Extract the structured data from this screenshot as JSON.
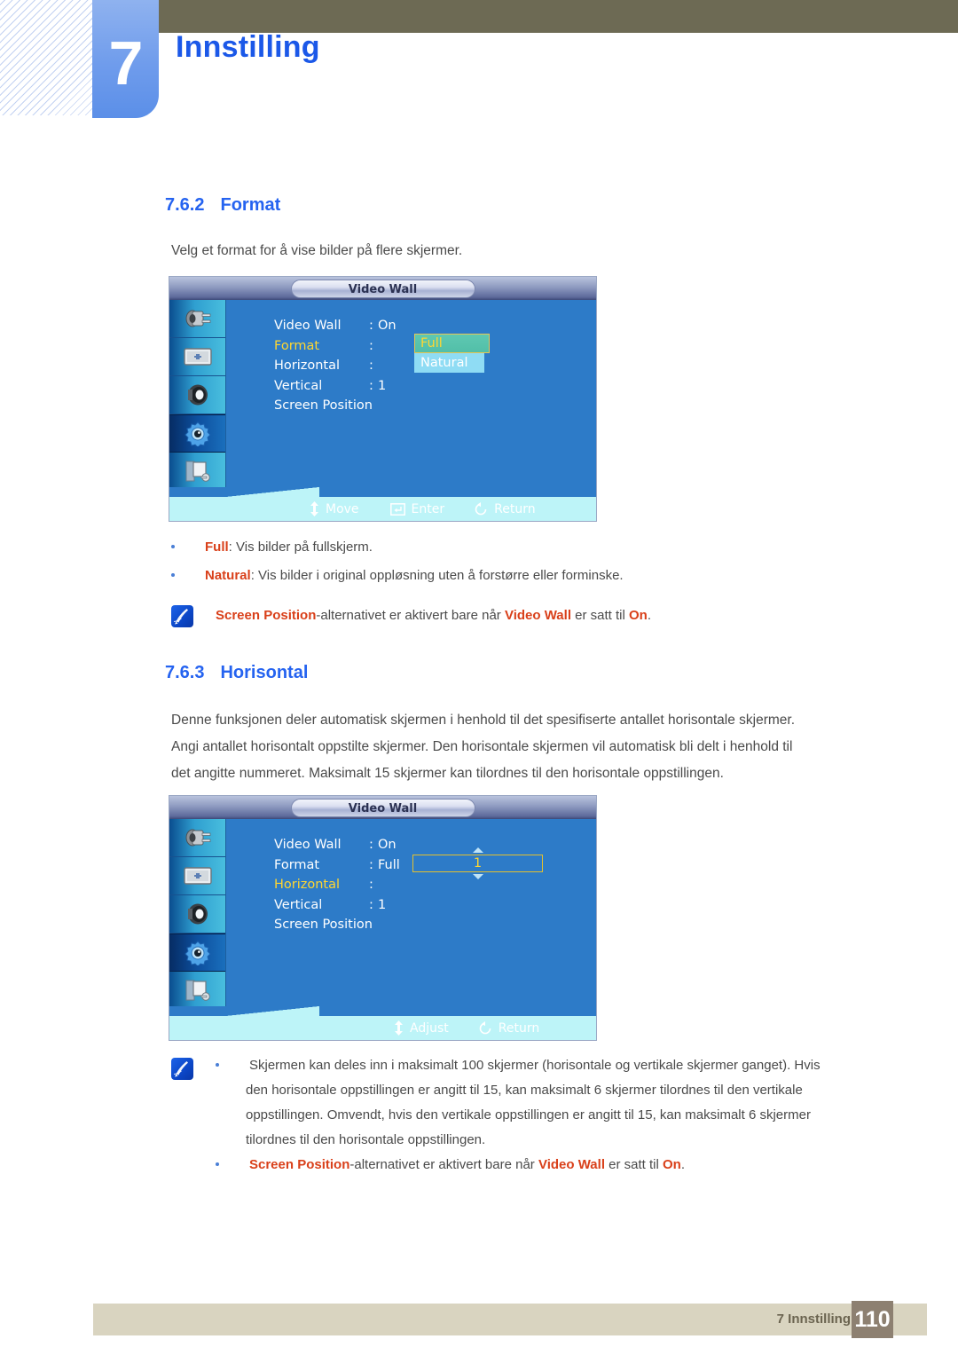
{
  "chapter": {
    "number": "7",
    "title": "Innstilling"
  },
  "sections": [
    {
      "number": "7.6.2",
      "title": "Format",
      "intro": "Velg et format for å vise bilder på flere skjermer."
    },
    {
      "number": "7.6.3",
      "title": "Horisontal",
      "intro_line1": "Denne funksjonen deler automatisk skjermen i henhold til det spesifiserte antallet horisontale skjermer.",
      "intro_line2": "Angi antallet horisontalt oppstilte skjermer. Den horisontale skjermen vil automatisk bli delt i henhold til",
      "intro_line3": "det angitte nummeret. Maksimalt 15 skjermer kan tilordnes til den horisontale oppstillingen."
    }
  ],
  "osd1": {
    "title": "Video Wall",
    "rows": [
      {
        "label": "Video Wall",
        "colon": ":",
        "value": "On",
        "highlight": false
      },
      {
        "label": "Format",
        "colon": ":",
        "value": "",
        "highlight": true
      },
      {
        "label": "Horizontal",
        "colon": ":",
        "value": "",
        "highlight": false
      },
      {
        "label": "Vertical",
        "colon": ":",
        "value": "1",
        "highlight": false
      },
      {
        "label": "Screen Position",
        "colon": "",
        "value": "",
        "highlight": false
      }
    ],
    "dropdown": {
      "selected": "Full",
      "other": "Natural"
    },
    "hints": [
      {
        "icon": "up-down-arrow-icon",
        "label": "Move"
      },
      {
        "icon": "enter-key-icon",
        "label": "Enter"
      },
      {
        "icon": "return-arrow-icon",
        "label": "Return"
      }
    ],
    "sidebar_icons": [
      "input-plug-icon",
      "picture-screen-icon",
      "speaker-icon",
      "gear-setup-icon",
      "multi-control-icon"
    ],
    "selected_sidebar_index": 3
  },
  "osd2": {
    "title": "Video Wall",
    "rows": [
      {
        "label": "Video Wall",
        "colon": ":",
        "value": "On",
        "highlight": false
      },
      {
        "label": "Format",
        "colon": ":",
        "value": "Full",
        "highlight": false
      },
      {
        "label": "Horizontal",
        "colon": ":",
        "value": "",
        "highlight": true
      },
      {
        "label": "Vertical",
        "colon": ":",
        "value": "1",
        "highlight": false
      },
      {
        "label": "Screen Position",
        "colon": "",
        "value": "",
        "highlight": false
      }
    ],
    "spinner": {
      "value": "1"
    },
    "hints": [
      {
        "icon": "up-down-arrow-icon",
        "label": "Adjust"
      },
      {
        "icon": "return-arrow-icon",
        "label": "Return"
      }
    ],
    "sidebar_icons": [
      "input-plug-icon",
      "picture-screen-icon",
      "speaker-icon",
      "gear-setup-icon",
      "multi-control-icon"
    ],
    "selected_sidebar_index": 3
  },
  "bullets_after_osd1": {
    "b1_term": "Full",
    "b1_rest": ": Vis bilder på fullskjerm.",
    "b2_term": "Natural",
    "b2_rest": ": Vis bilder i original oppløsning uten å forstørre eller forminske."
  },
  "note1": {
    "icon": "note-pen-icon",
    "t1": "Screen Position",
    "t2": "-alternativet er aktivert bare når ",
    "t3": "Video Wall",
    "t4": " er satt til ",
    "t5": "On",
    "t6": "."
  },
  "note2": {
    "icon": "note-pen-icon",
    "line1": "Skjermen kan deles inn i maksimalt 100 skjermer (horisontale og vertikale skjermer ganget). Hvis",
    "line2": "den horisontale oppstillingen er angitt til 15, kan maksimalt 6 skjermer tilordnes til den vertikale",
    "line3": "oppstillingen. Omvendt, hvis den vertikale oppstillingen er angitt til 15, kan maksimalt 6 skjermer",
    "line4": "tilordnes til den horisontale oppstillingen.",
    "b2_t1": "Screen Position",
    "b2_t2": "-alternativet er aktivert bare når ",
    "b2_t3": "Video Wall",
    "b2_t4": " er satt til ",
    "b2_t5": "On",
    "b2_t6": "."
  },
  "footer": {
    "label": "7 Innstilling",
    "page": "110"
  },
  "colors": {
    "accent_blue": "#2563f0",
    "chapter_tab": "#6f9cec",
    "olive": "#6d6a54",
    "red_term": "#d9401a",
    "osd_blue": "#2d7bc8",
    "osd_highlight": "#ffd630",
    "footer_bar": "#d9d4c0",
    "footer_page": "#8d8071"
  }
}
